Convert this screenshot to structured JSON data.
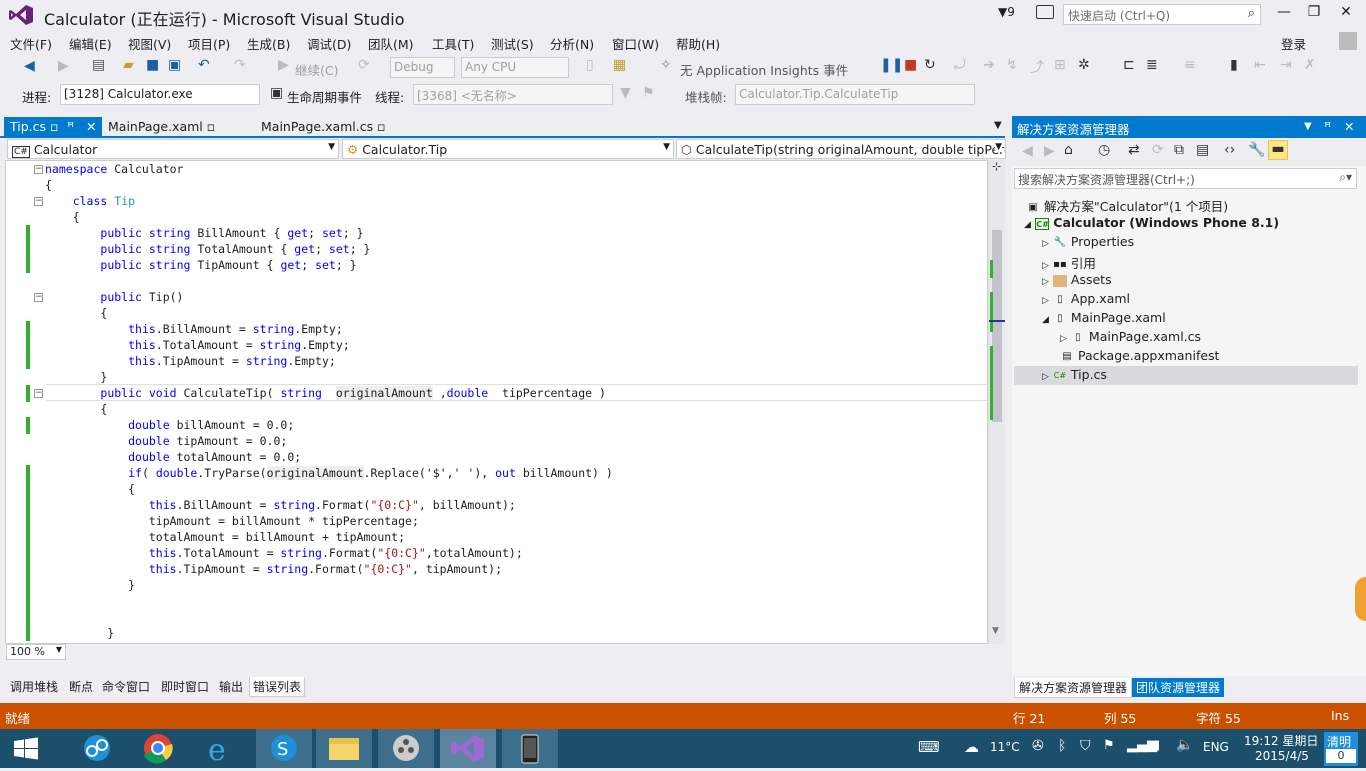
{
  "window": {
    "title": "Calculator (正在运行) - Microsoft Visual Studio",
    "notification_count": "9",
    "quick_launch_placeholder": "快速启动 (Ctrl+Q)",
    "login": "登录"
  },
  "menu": [
    "文件(F)",
    "编辑(E)",
    "视图(V)",
    "项目(P)",
    "生成(B)",
    "调试(D)",
    "团队(M)",
    "工具(T)",
    "测试(S)",
    "分析(N)",
    "窗口(W)",
    "帮助(H)"
  ],
  "toolbar": {
    "continue": "继续(C)",
    "config": "Debug",
    "platform": "Any CPU",
    "insights": "无 Application Insights 事件",
    "process_label": "进程:",
    "process_value": "[3128] Calculator.exe",
    "lifecycle": "生命周期事件",
    "thread_label": "线程:",
    "thread_value": "[3368] <无名称>",
    "stackframe_label": "堆栈帧:",
    "stackframe_value": "Calculator.Tip.CalculateTip"
  },
  "tabs": [
    {
      "label": "Tip.cs"
    },
    {
      "label": "MainPage.xaml"
    },
    {
      "label": "MainPage.xaml.cs"
    }
  ],
  "nav": {
    "project": "Calculator",
    "type": "Calculator.Tip",
    "member": "CalculateTip(string originalAmount, double tipPerce"
  },
  "code_lines": [
    "namespace Calculator",
    "{",
    "    class Tip",
    "    {",
    "        public string BillAmount { get; set; }",
    "        public string TotalAmount { get; set; }",
    "        public string TipAmount { get; set; }",
    "",
    "        public Tip()",
    "        {",
    "            this.BillAmount = string.Empty;",
    "            this.TotalAmount = string.Empty;",
    "            this.TipAmount = string.Empty;",
    "        }",
    "        public void CalculateTip( string  originalAmount ,double  tipPercentage )",
    "        {",
    "            double billAmount = 0.0;",
    "            double tipAmount = 0.0;",
    "            double totalAmount = 0.0;",
    "            if( double.TryParse(originalAmount.Replace('$',' '), out billAmount) )",
    "            {",
    "               this.BillAmount = string.Format(\"{0:C}\", billAmount);",
    "               tipAmount = billAmount * tipPercentage;",
    "               totalAmount = billAmount + tipAmount;",
    "               this.TotalAmount = string.Format(\"{0:C}\",totalAmount);",
    "               this.TipAmount = string.Format(\"{0:C}\", tipAmount);",
    "            }",
    "",
    "",
    "         }"
  ],
  "zoom": "100 %",
  "bottom_tabs": [
    "调用堆栈",
    "断点",
    "命令窗口",
    "即时窗口",
    "输出",
    "错误列表"
  ],
  "status": {
    "ready": "就绪",
    "line": "行 21",
    "col": "列 55",
    "char": "字符 55",
    "ins": "Ins"
  },
  "solution_explorer": {
    "title": "解决方案资源管理器",
    "search_placeholder": "搜索解决方案资源管理器(Ctrl+;)",
    "solution": "解决方案\"Calculator\"(1 个项目)",
    "project": "Calculator (Windows Phone 8.1)",
    "items": [
      "Properties",
      "引用",
      "Assets",
      "App.xaml",
      "MainPage.xaml",
      "MainPage.xaml.cs",
      "Package.appxmanifest",
      "Tip.cs"
    ],
    "bottom_tabs": [
      "解决方案资源管理器",
      "团队资源管理器"
    ]
  },
  "taskbar": {
    "temp": "11°C",
    "lang": "ENG",
    "time": "19:12 星期日",
    "date": "2015/4/5",
    "clear": "清明",
    "clear_count": "0"
  },
  "colors": {
    "accent": "#007acc",
    "status_debug": "#ca5100",
    "taskbar": "#1c4f6c",
    "vs_purple": "#68217a"
  }
}
